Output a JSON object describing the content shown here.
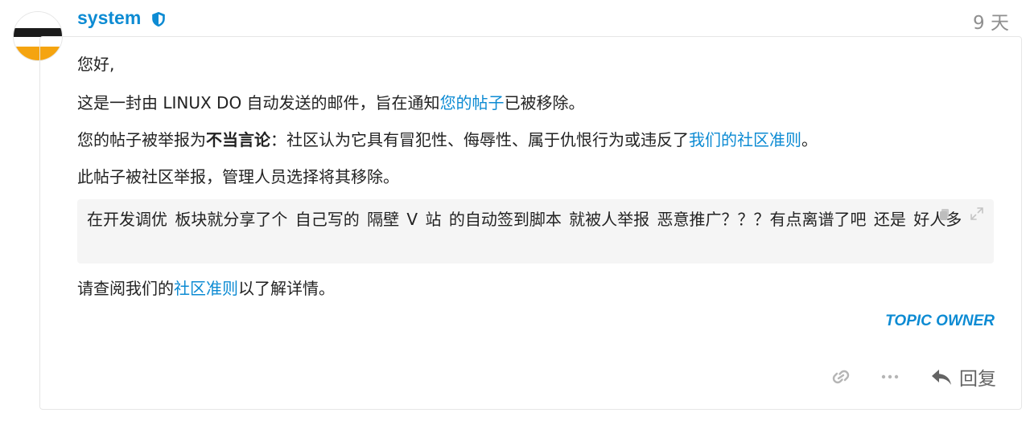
{
  "post": {
    "author": "system",
    "date": "9 天",
    "greeting": "您好,",
    "line1": {
      "before": "这是一封由 LINUX DO 自动发送的邮件，旨在通知",
      "link": "您的帖子",
      "after": "已被移除。"
    },
    "line2": {
      "before": "您的帖子被举报为",
      "bold": "不当言论",
      "middle": "：社区认为它具有冒犯性、侮辱性、属于仇恨行为或违反了",
      "link": "我们的社区准则",
      "after": "。"
    },
    "line3": "此帖子被社区举报，管理人员选择将其移除。",
    "quote": "在开发调优 板块就分享了个 自己写的 隔壁 V 站 的自动签到脚本 就被人举报 恶意推广？？？有点离谱了吧 还是 好人多",
    "line4": {
      "before": "请查阅我们的",
      "link": "社区准则",
      "after": "以了解详情。"
    },
    "topic_owner_label": "TOPIC OWNER",
    "reply_label": "回复"
  },
  "icons": {
    "badge": "shield-icon",
    "copy": "copy-icon",
    "expand": "expand-icon",
    "link": "link-icon",
    "more": "ellipsis-icon",
    "reply": "reply-arrow-icon"
  },
  "colors": {
    "accent": "#0d8bd3",
    "muted": "#8f8f8f",
    "quote_bg": "#f5f5f5",
    "avatar_yellow": "#f5a410"
  }
}
